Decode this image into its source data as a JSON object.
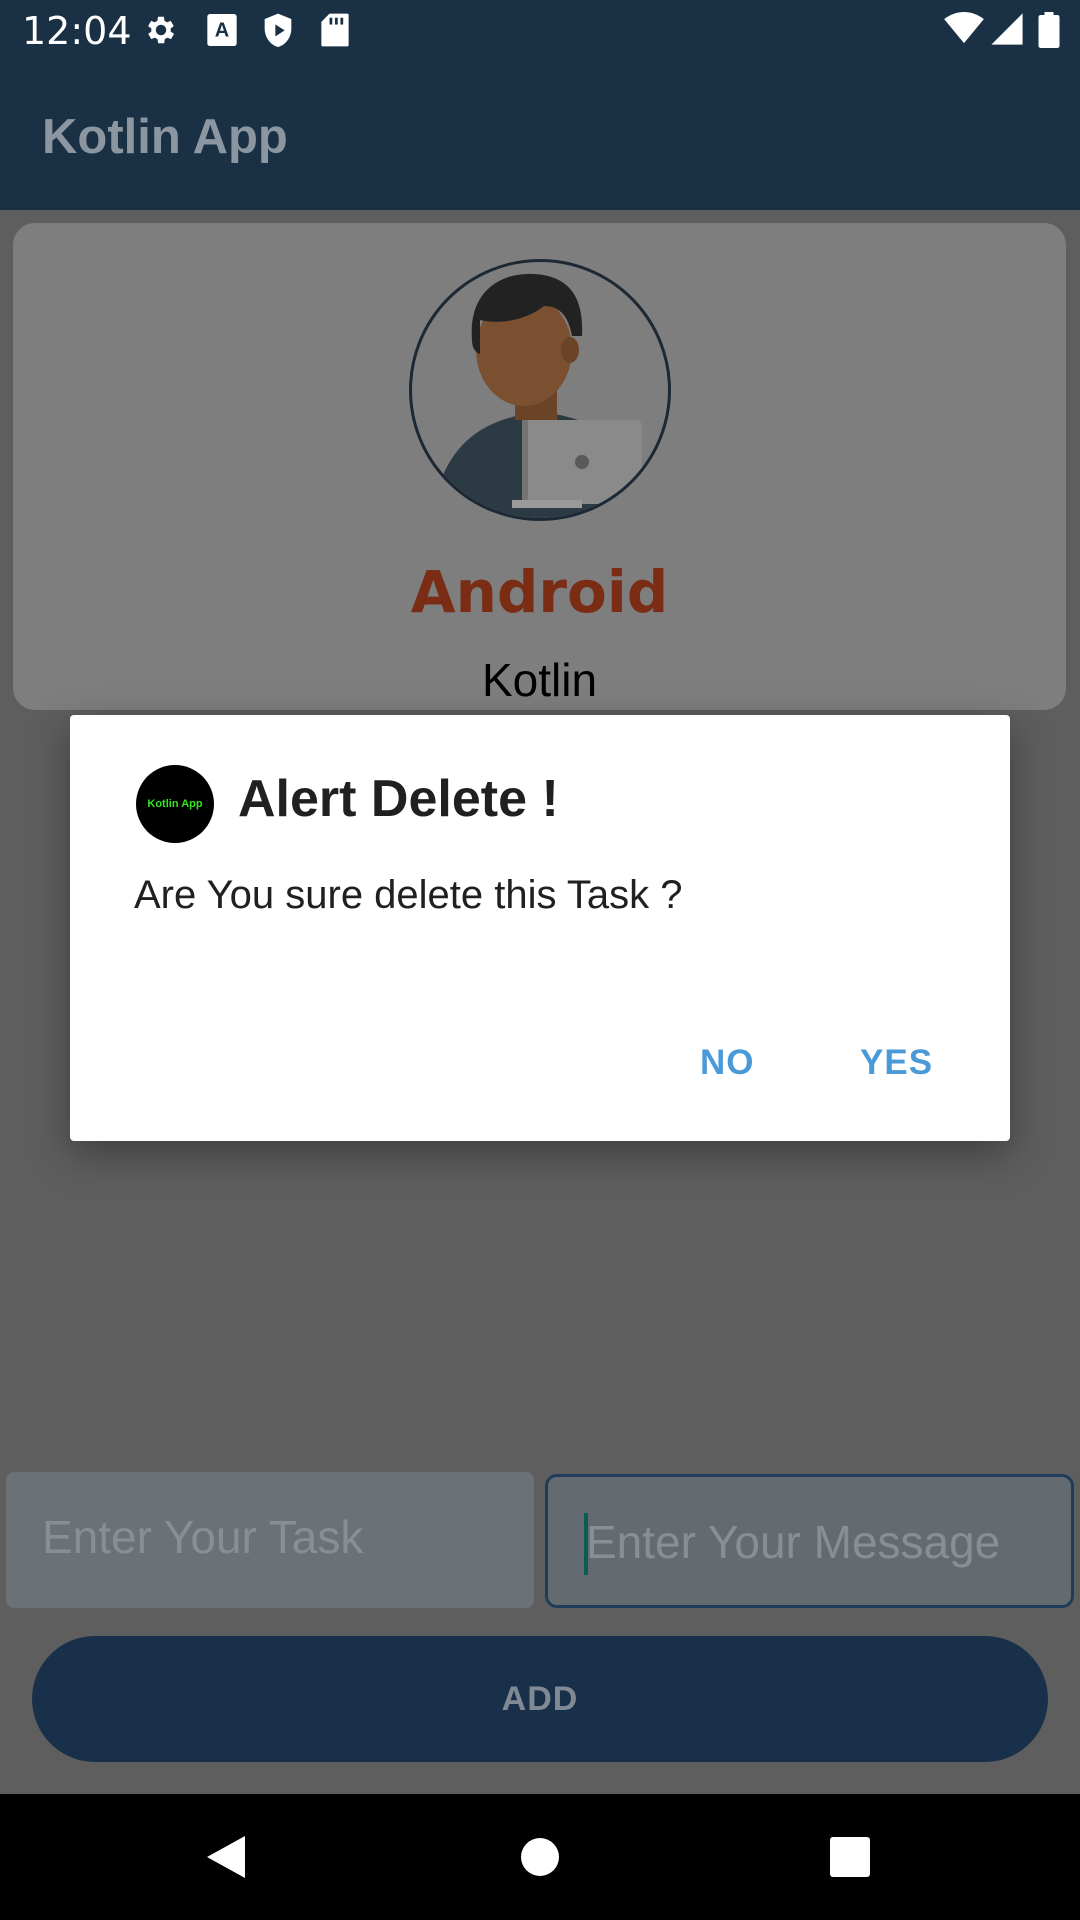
{
  "status_bar": {
    "time": "12:04",
    "left_icons": [
      "gear-icon",
      "font-a-icon",
      "shield-icon",
      "sd-card-icon"
    ],
    "right_icons": [
      "wifi-icon",
      "cell-signal-icon",
      "battery-icon"
    ]
  },
  "app_bar": {
    "title": "Kotlin App"
  },
  "profile": {
    "avatar_icon": "person-with-laptop-avatar",
    "name": "Android",
    "subtitle": "Kotlin"
  },
  "form": {
    "task_placeholder": "Enter Your Task",
    "message_placeholder": "Enter Your Message",
    "add_label": "ADD"
  },
  "dialog": {
    "logo_text": "Kotlin App",
    "title": "Alert Delete !",
    "message": "Are You sure delete this Task ?",
    "negative_label": "NO",
    "positive_label": "YES"
  },
  "nav_bar": {
    "back_icon": "back-triangle-icon",
    "home_icon": "home-circle-icon",
    "recents_icon": "recents-square-icon"
  },
  "colors": {
    "app_bar": "#1a3045",
    "accent_button": "#4a9ad8",
    "profile_name": "#7a2d14",
    "logo_text": "#32e61e"
  }
}
